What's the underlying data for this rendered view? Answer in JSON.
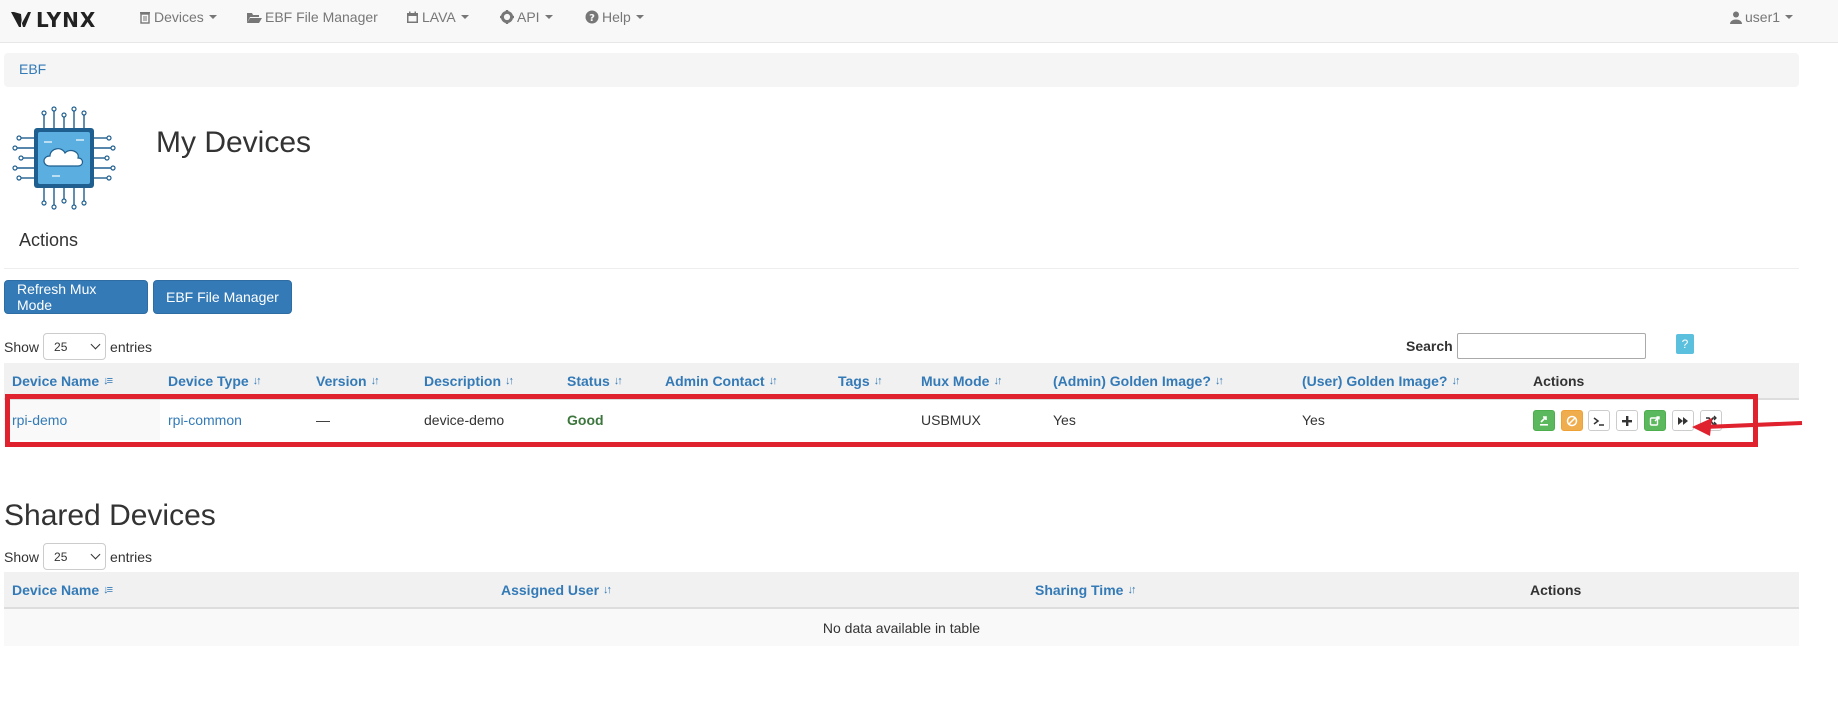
{
  "navbar": {
    "brand": "LYNX",
    "items": [
      {
        "label": "Devices",
        "icon": "trash-icon"
      },
      {
        "label": "EBF File Manager",
        "icon": "folder-open-icon"
      },
      {
        "label": "LAVA",
        "icon": "calendar-icon"
      },
      {
        "label": "API",
        "icon": "gear-icon"
      },
      {
        "label": "Help",
        "icon": "question-circle-icon"
      }
    ],
    "user": "user1"
  },
  "breadcrumb": {
    "label": "EBF"
  },
  "page": {
    "title": "My Devices",
    "actions_heading": "Actions"
  },
  "buttons": {
    "refresh_mux": "Refresh Mux Mode",
    "ebf_file_manager": "EBF File Manager"
  },
  "my_devices": {
    "show_label": "Show",
    "entries_value": "25",
    "entries_label": "entries",
    "search_label": "Search",
    "search_value": "",
    "help_label": "?",
    "columns": [
      "Device Name",
      "Device Type",
      "Version",
      "Description",
      "Status",
      "Admin Contact",
      "Tags",
      "Mux Mode",
      "(Admin) Golden Image?",
      "(User) Golden Image?",
      "Actions"
    ],
    "rows": [
      {
        "device_name": "rpi-demo",
        "device_type": "rpi-common",
        "version": "—",
        "description": "device-demo",
        "status": "Good",
        "admin_contact": "",
        "tags": "",
        "mux_mode": "USBMUX",
        "admin_golden": "Yes",
        "user_golden": "Yes",
        "action_icons": [
          "upload-icon",
          "ban-icon",
          "terminal-icon",
          "plus-icon",
          "share-icon",
          "fast-forward-icon",
          "random-icon"
        ]
      }
    ]
  },
  "shared_devices": {
    "title": "Shared Devices",
    "show_label": "Show",
    "entries_value": "25",
    "entries_label": "entries",
    "columns": [
      "Device Name",
      "Assigned User",
      "Sharing Time",
      "Actions"
    ],
    "empty_message": "No data available in table"
  },
  "colors": {
    "link": "#337ab7",
    "primary": "#337ab7",
    "success": "#5cb85c",
    "warning": "#f0ad4e",
    "info": "#5bc0de",
    "good_status": "#3c763d",
    "highlight": "#e0212e"
  }
}
